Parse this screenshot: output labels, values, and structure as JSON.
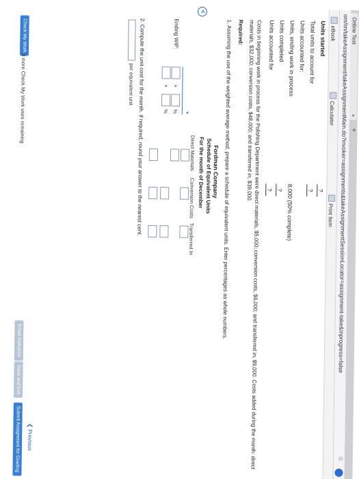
{
  "browser": {
    "tab_title": "Online Test",
    "url": "om/im/takeAssignment/takeAssignmentMain.do?invoker=assignments&takeAssignmentSessionLocator=assignment-take&inprogress=false"
  },
  "toolbar": {
    "ebook": "eBook",
    "calculator": "Calculator",
    "print": "Print Item"
  },
  "units": {
    "started_label": "Units started",
    "started_value": "?",
    "total_label": "Total units to account for",
    "total_value": "?",
    "accounted_heading": "Units accounted for:",
    "ending_label": "Units, ending work in process",
    "ending_value": "8,000 (50% complete)",
    "completed_label": "Units completed",
    "completed_value": "?",
    "accounted_label": "Units accounted for",
    "accounted_value": "?"
  },
  "costs_paragraph": "Costs in beginning work in process for the Polishing Department were direct materials, $5,000; conversion costs, $6,000; and transferred in, $9,000. Costs added during the month: direct materials, $32,000; conversion costs, $48,000; and transferred in, $39,000.",
  "required_label": "Required:",
  "q1": "1. Assuming the use of the weighted average method, prepare a schedule of equivalent units. Enter percentages as whole numbers.",
  "schedule": {
    "company": "Fordman Company",
    "title": "Schedule of Equivalent Units",
    "period": "For the month of December",
    "col1": "Direct Materials",
    "col2": "Conversion Costs",
    "col3": "Transferred In",
    "ending_wip": "Ending WIP:",
    "times": "×",
    "percent": "%"
  },
  "q2": "2. Compute the unit cost for the month. If required, round your answer to the nearest cent.",
  "unit_cost_suffix": "per equivalent unit",
  "footer": {
    "check_button": "Check My Work",
    "check_note": "3 more Check My Work uses remaining",
    "previous": "Previous",
    "email_button": "Email Instructor",
    "save_button": "Save and Exit",
    "submit_button": "Submit Assignment for Grading"
  },
  "colors": {
    "accent": "#3a80d2",
    "link": "#2a67c9"
  }
}
